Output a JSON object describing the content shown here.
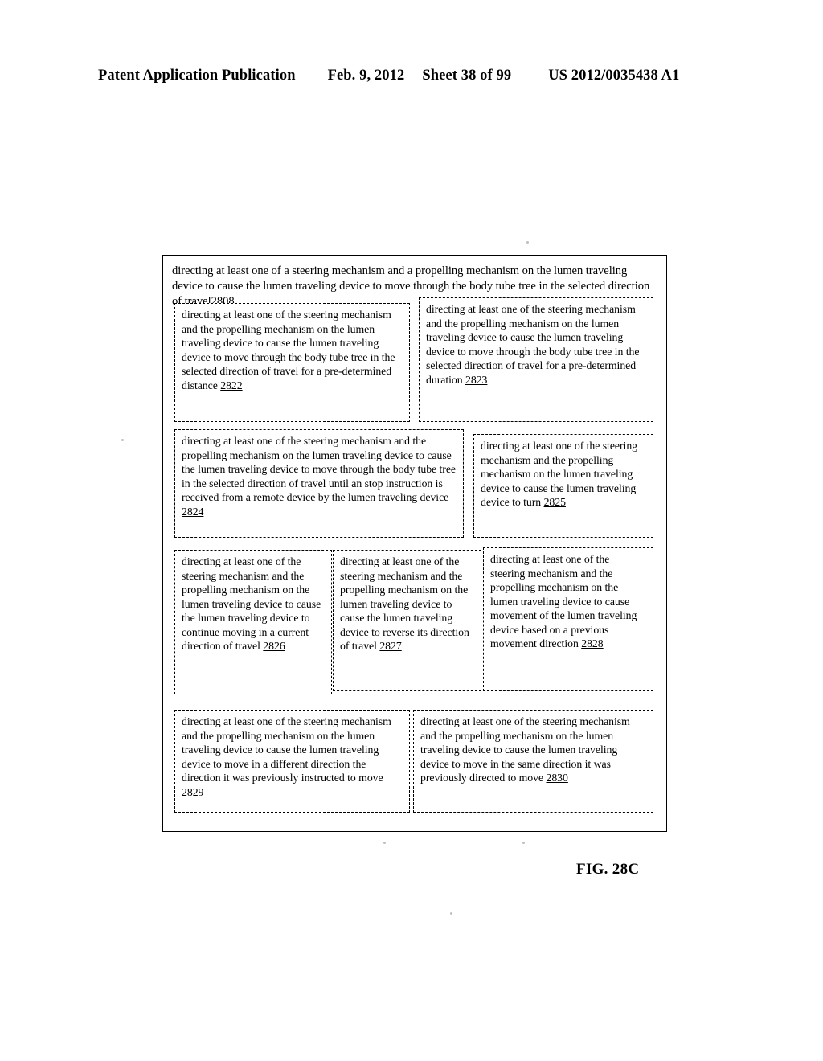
{
  "header": {
    "publication": "Patent Application Publication",
    "date": "Feb. 9, 2012",
    "sheet": "Sheet 38 of 99",
    "doc_number": "US 2012/0035438 A1"
  },
  "figure": {
    "caption": "FIG. 28C",
    "outer_block": {
      "ref": "2808",
      "text": "directing at least one of a steering mechanism and a propelling mechanism on the lumen traveling device to cause the lumen traveling device to move through the body tube tree in the selected direction of travel"
    },
    "boxes": [
      {
        "ref": "2822",
        "text": "directing at least one of the steering mechanism and the propelling mechanism on the lumen traveling device to cause the lumen traveling device to move through the body tube tree in the selected direction of travel for a pre-determined distance"
      },
      {
        "ref": "2823",
        "text": "directing at least one of the steering mechanism and the propelling mechanism on the lumen traveling device to cause the lumen traveling device to move through the body tube tree in the selected direction of travel for a pre-determined duration"
      },
      {
        "ref": "2824",
        "text": "directing at least one of the steering mechanism and the propelling mechanism on the lumen traveling device to cause the lumen traveling device to move through the body tube tree in the selected direction of travel until an stop instruction is received from a remote device by the lumen traveling device"
      },
      {
        "ref": "2825",
        "text": "directing at least one of the steering mechanism and the propelling mechanism on the lumen traveling device to cause the lumen traveling device to turn"
      },
      {
        "ref": "2826",
        "text": "directing at least one of the steering mechanism and the propelling mechanism on the lumen traveling device to cause the lumen traveling device to continue moving in a current direction of travel"
      },
      {
        "ref": "2827",
        "text": "directing at least one of the steering mechanism and the propelling mechanism on the lumen traveling device to cause the lumen traveling device to reverse its direction of travel"
      },
      {
        "ref": "2828",
        "text": "directing at least one of the steering mechanism and the propelling mechanism on the lumen traveling device to cause movement of the lumen traveling device based on a previous movement direction"
      },
      {
        "ref": "2829",
        "text": "directing at least one of the steering mechanism and the propelling mechanism on the lumen traveling device to cause the lumen traveling device to move in a different direction the direction it was previously instructed to move"
      },
      {
        "ref": "2830",
        "text": "directing at least one of the steering mechanism and the propelling mechanism on the lumen traveling device to cause the lumen traveling device to move in the same direction it was previously directed to move"
      }
    ]
  },
  "colors": {
    "ink": "#000000",
    "page": "#ffffff"
  }
}
